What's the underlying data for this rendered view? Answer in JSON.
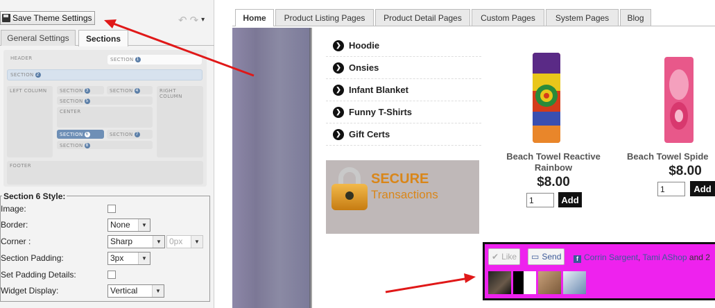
{
  "toolbar": {
    "save_label": "Save Theme Settings",
    "undo_icon": "↶",
    "redo_icon": "↷",
    "menu_icon": "▾"
  },
  "left_tabs": [
    "General Settings",
    "Sections"
  ],
  "layout": {
    "header": "Header",
    "footer": "Footer",
    "left_column": "Left Column",
    "right_column": "Right Column",
    "center": "Center",
    "section_word": "Section",
    "nums": [
      "1",
      "2",
      "3",
      "4",
      "5",
      "6",
      "7",
      "8"
    ]
  },
  "section_style": {
    "title": "Section 6 Style:",
    "image_label": "Image:",
    "border_label": "Border:",
    "border_value": "None",
    "corner_label": "Corner :",
    "corner_value": "Sharp",
    "corner_size": "0px",
    "padding_label": "Section Padding:",
    "padding_value": "3px",
    "padding_details_label": "Set Padding Details:",
    "widget_label": "Widget Display:",
    "widget_value": "Vertical"
  },
  "nav_tabs": [
    "Home",
    "Product Listing Pages",
    "Product Detail Pages",
    "Custom Pages",
    "System Pages",
    "Blog"
  ],
  "categories": [
    "Hoodie",
    "Onsies",
    "Infant Blanket",
    "Funny T-Shirts",
    "Gift Certs"
  ],
  "secure": {
    "line1": "SECURE",
    "line2": "Transactions"
  },
  "products": [
    {
      "title_1": "Beach Towel Reactive",
      "title_2": "Rainbow",
      "price": "$8.00",
      "qty": "1",
      "add": "Add"
    },
    {
      "title_1": "Beach Towel Spide",
      "title_2": "",
      "price": "$8.00",
      "qty": "1",
      "add": "Add"
    }
  ],
  "facebook": {
    "like": "Like",
    "send": "Send",
    "friend1": "Corrin Sargent",
    "sep": ",",
    "friend2": "Tami AShop",
    "tail": "and 2"
  },
  "colors": {
    "accent_arrow": "#e01818",
    "fb_bg": "#ee22ee",
    "price_text": "#222222"
  }
}
